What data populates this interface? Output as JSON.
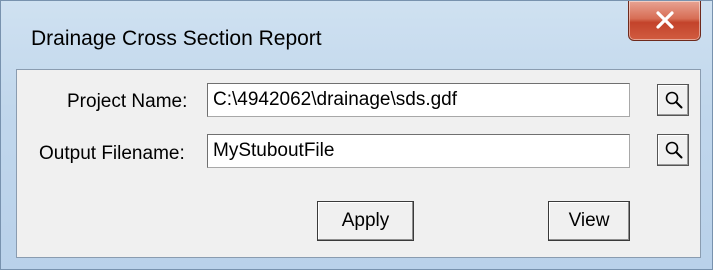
{
  "window": {
    "title": "Drainage Cross Section Report",
    "close_icon": "close-icon",
    "close_color": "#c94a31"
  },
  "form": {
    "project_name_label": "Project Name:",
    "project_name_value": "C:\\4942062\\drainage\\sds.gdf",
    "output_filename_label": "Output Filename:",
    "output_filename_value": "MyStuboutFile",
    "browse_icon": "magnifier-icon"
  },
  "buttons": {
    "apply_label": "Apply",
    "view_label": "View"
  }
}
